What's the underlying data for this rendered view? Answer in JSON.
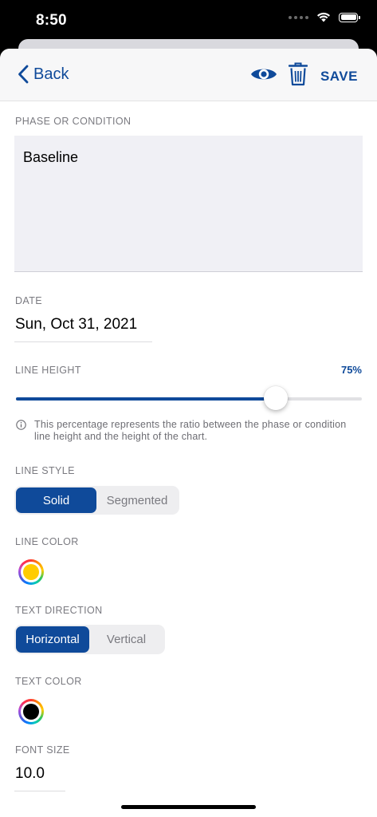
{
  "status_bar": {
    "time": "8:50"
  },
  "nav": {
    "back_label": "Back",
    "save_label": "SAVE"
  },
  "phase": {
    "label": "PHASE OR CONDITION",
    "value": "Baseline"
  },
  "date": {
    "label": "DATE",
    "value": "Sun, Oct 31, 2021"
  },
  "line_height": {
    "label": "LINE HEIGHT",
    "percent_text": "75%",
    "value": 0.75,
    "info": "This percentage represents the ratio between the phase or condition line height and the height of the chart."
  },
  "line_style": {
    "label": "LINE STYLE",
    "options": [
      "Solid",
      "Segmented"
    ],
    "selected": "Solid"
  },
  "line_color": {
    "label": "LINE COLOR",
    "color": "#FFCC00"
  },
  "text_direction": {
    "label": "TEXT DIRECTION",
    "options": [
      "Horizontal",
      "Vertical"
    ],
    "selected": "Horizontal"
  },
  "text_color": {
    "label": "TEXT COLOR",
    "color": "#000000"
  },
  "font_size": {
    "label": "FONT SIZE",
    "value": "10.0"
  },
  "colors": {
    "accent": "#0F4A9A",
    "secondary_text": "#7A7A80",
    "input_bg": "#F0F0F5"
  }
}
